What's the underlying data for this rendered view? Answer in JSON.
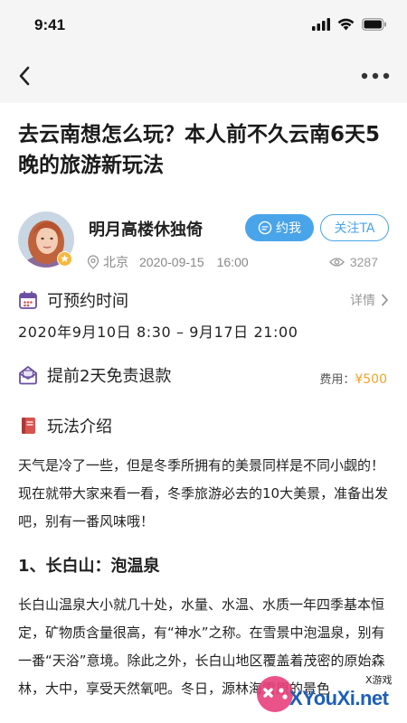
{
  "status_bar": {
    "time": "9:41",
    "icons": [
      "signal-icon",
      "wifi-icon",
      "battery-icon"
    ]
  },
  "nav": {
    "back_icon": "chevron-left-icon",
    "more_icon": "more-dots-icon"
  },
  "post": {
    "title": "去云南想怎么玩？本人前不久云南6天5晚的旅游新玩法",
    "author": {
      "name": "明月高楼休独倚",
      "location": "北京",
      "date": "2020-09-15",
      "time": "16:00",
      "badge_icon": "star-badge-icon"
    },
    "actions": {
      "appoint_label": "约我",
      "follow_label": "关注TA"
    },
    "views": "3287"
  },
  "schedule": {
    "label": "可预约时间",
    "detail_label": "详情",
    "range": "2020年9月10日 8:30 – 9月17日 21:00"
  },
  "refund": {
    "label": "提前2天免责退款",
    "fee_label": "费用：",
    "fee_value": "¥500"
  },
  "intro": {
    "label": "玩法介绍",
    "paragraph1": "天气是冷了一些，但是冬季所拥有的美景同样是不同小觑的！现在就带大家来看一看，冬季旅游必去的10大美景，准备出发吧，别有一番风味哦！",
    "subheading": "1、长白山：泡温泉",
    "paragraph2": "长白山温泉大小就几十处，水量、水温、水质一年四季基本恒定，矿物质含量很高，有“神水”之称。在雪景中泡温泉，别有一番“天浴”意境。除此之外，长白山地区覆盖着茂密的原始森林，大中，享受天然氧吧。冬日，源林海雪原的景色"
  },
  "watermark": {
    "small": "X游戏",
    "text": "XYouXi.net"
  },
  "colors": {
    "accent": "#4aa4e9",
    "price": "#f0a327",
    "header_bg": "#f5f5f6",
    "icon_purple": "#6a4fa3",
    "icon_red": "#d9534f"
  }
}
